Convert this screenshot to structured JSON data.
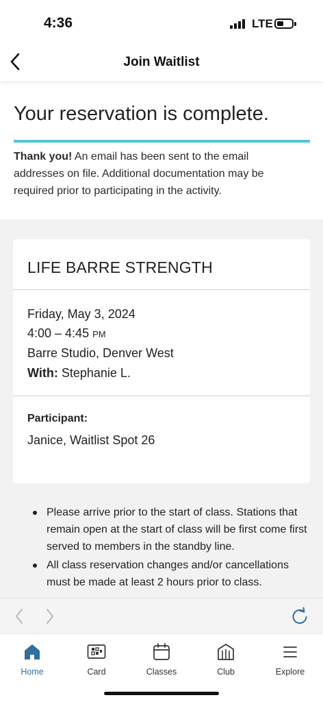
{
  "status_bar": {
    "time": "4:36",
    "network": "LTE"
  },
  "header": {
    "title": "Join Waitlist"
  },
  "confirmation": {
    "title": "Your reservation is complete.",
    "thanks": "Thank you!",
    "message": " An email has been sent to the email addresses on file. Additional documentation may be required prior to participating in the activity."
  },
  "class_card": {
    "name": "LIFE BARRE STRENGTH",
    "date": "Friday, May 3, 2024",
    "time": "4:00 – 4:45",
    "ampm": "PM",
    "location": "Barre Studio, Denver West",
    "instructor_label": "With:",
    "instructor": " Stephanie L.",
    "participant_label": "Participant:",
    "participant": "Janice, Waitlist Spot 26"
  },
  "notes": [
    "Please arrive prior to the start of class. Stations that remain open at the start of class will be first come first served to members in the standby line.",
    "All class reservation changes and/or cancellations must be made at least 2 hours prior to class."
  ],
  "tabs": [
    {
      "label": "Home",
      "icon": "home-icon",
      "active": true
    },
    {
      "label": "Card",
      "icon": "card-icon",
      "active": false
    },
    {
      "label": "Classes",
      "icon": "calendar-icon",
      "active": false
    },
    {
      "label": "Club",
      "icon": "club-icon",
      "active": false
    },
    {
      "label": "Explore",
      "icon": "menu-icon",
      "active": false
    }
  ],
  "colors": {
    "accent": "#4ec3dc",
    "active_tab": "#2f6fa3",
    "reload": "#2f6fa3",
    "disabled": "#b8b8b8"
  }
}
